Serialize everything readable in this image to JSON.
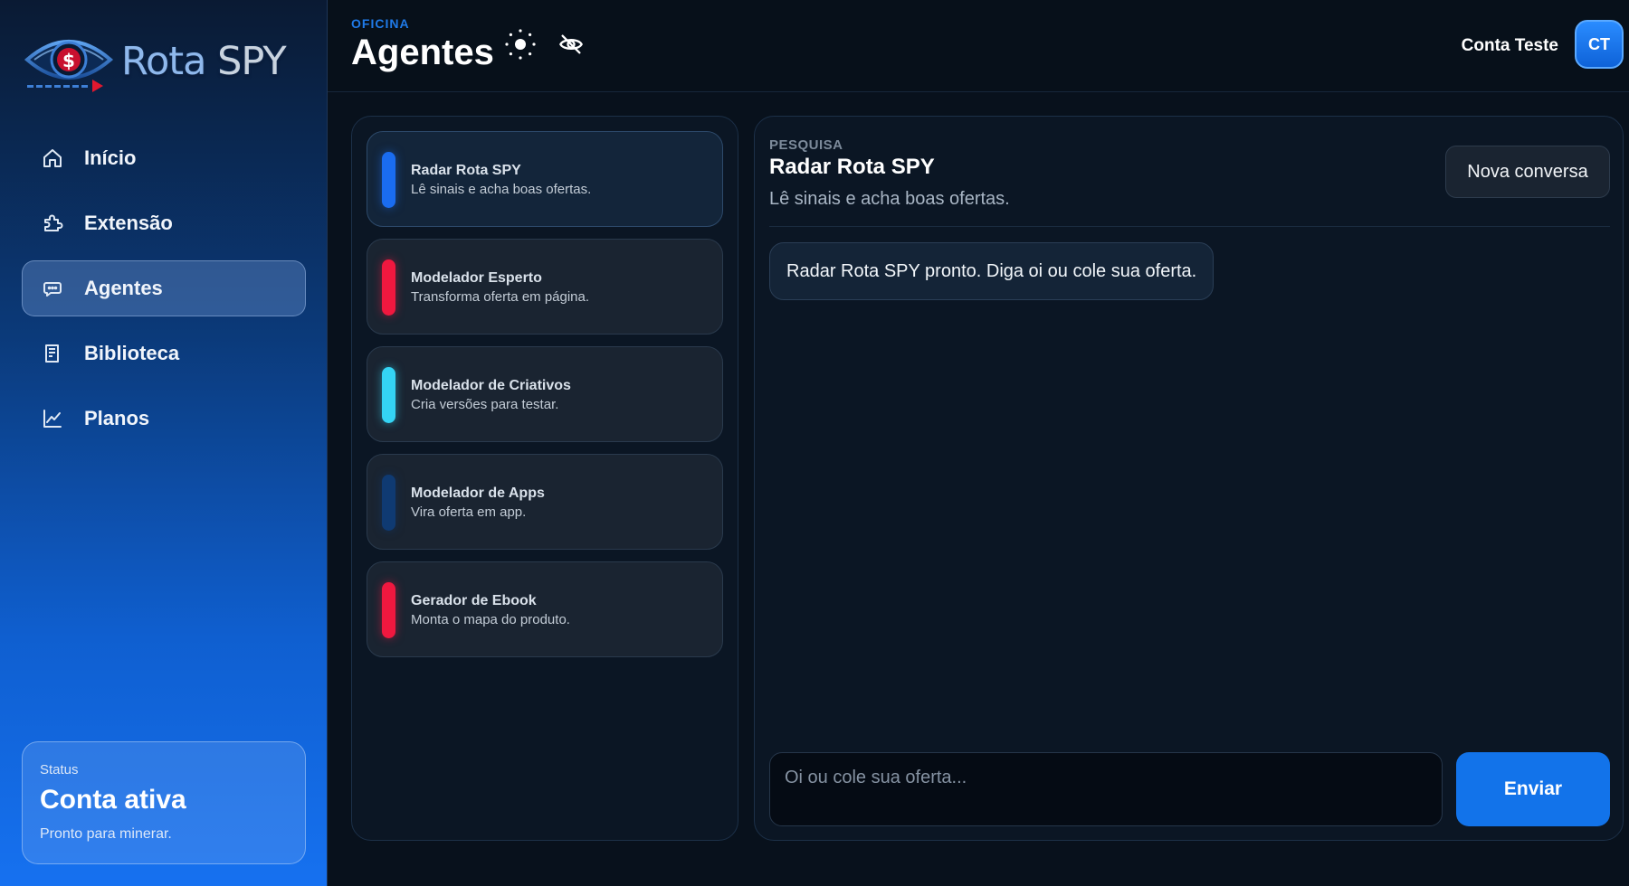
{
  "brand": {
    "name_part1": "Rota",
    "name_part2": "SPY",
    "icon": "eye-dollar-logo"
  },
  "sidebar": {
    "items": [
      {
        "label": "Início",
        "icon": "home-icon",
        "active": false
      },
      {
        "label": "Extensão",
        "icon": "puzzle-icon",
        "active": false
      },
      {
        "label": "Agentes",
        "icon": "chat-bubble-icon",
        "active": true
      },
      {
        "label": "Biblioteca",
        "icon": "book-icon",
        "active": false
      },
      {
        "label": "Planos",
        "icon": "chart-line-icon",
        "active": false
      }
    ],
    "status": {
      "label": "Status",
      "title": "Conta ativa",
      "subtitle": "Pronto para minerar."
    }
  },
  "header": {
    "eyebrow": "OFICINA",
    "title": "Agentes",
    "theme_icon": "sun-icon",
    "privacy_icon": "eye-off-icon",
    "user_name": "Conta Teste",
    "avatar_initials": "CT"
  },
  "agents": [
    {
      "name": "Radar Rota SPY",
      "description": "Lê sinais e acha boas ofertas.",
      "color": "#1a6cf0",
      "selected": true
    },
    {
      "name": "Modelador Esperto",
      "description": "Transforma oferta em página.",
      "color": "#f0183f",
      "selected": false
    },
    {
      "name": "Modelador de Criativos",
      "description": "Cria versões para testar.",
      "color": "#34d4f4",
      "selected": false
    },
    {
      "name": "Modelador de Apps",
      "description": "Vira oferta em app.",
      "color": "#0f3a72",
      "selected": false
    },
    {
      "name": "Gerador de Ebook",
      "description": "Monta o mapa do produto.",
      "color": "#f0183f",
      "selected": false
    }
  ],
  "chat": {
    "eyebrow": "PESQUISA",
    "title": "Radar Rota SPY",
    "subtitle": "Lê sinais e acha boas ofertas.",
    "new_chat_label": "Nova conversa",
    "messages": [
      {
        "text": "Radar Rota SPY pronto. Diga oi ou cole sua oferta."
      }
    ],
    "input_placeholder": "Oi ou cole sua oferta...",
    "send_label": "Enviar"
  },
  "colors": {
    "accent": "#1273ea",
    "eyebrow": "#1f7ae8",
    "panel": "#0b1624"
  }
}
